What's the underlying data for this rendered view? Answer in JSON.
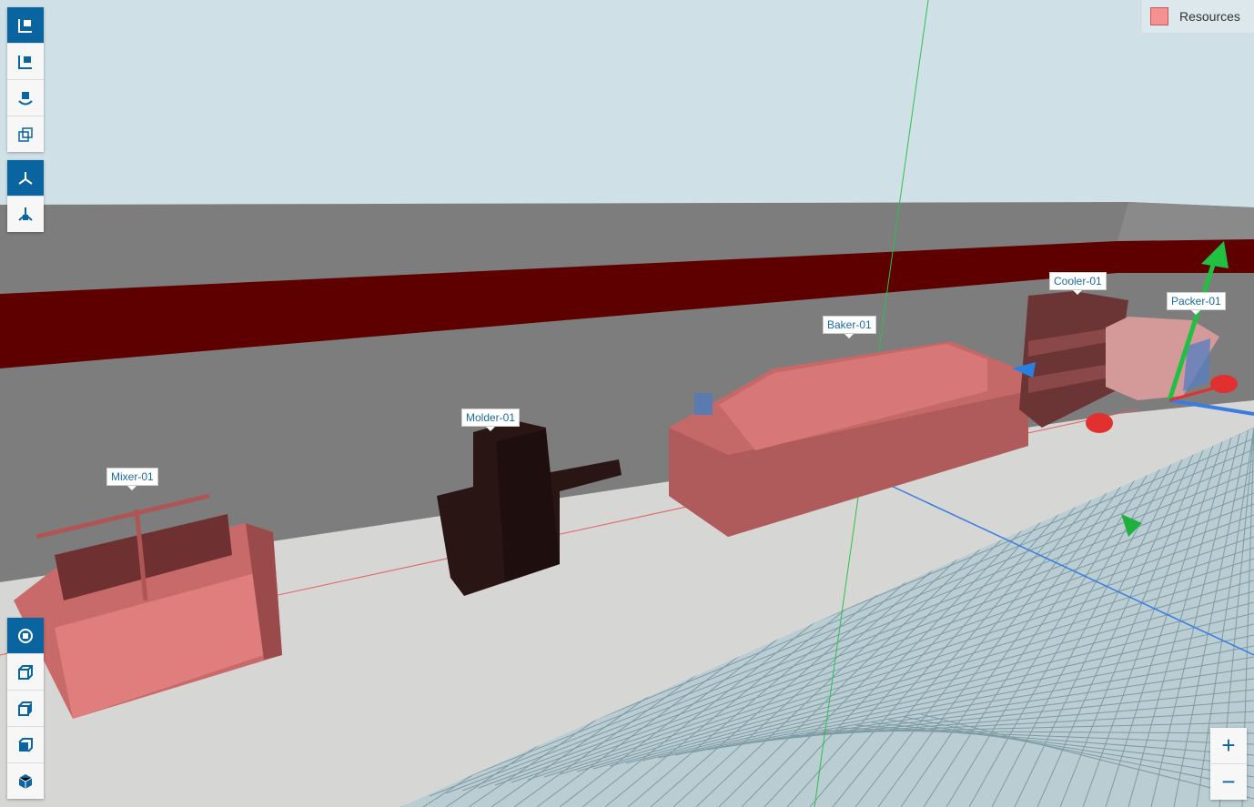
{
  "legend": {
    "label": "Resources",
    "color": "#f59191"
  },
  "labels": {
    "mixer": "Mixer-01",
    "molder": "Molder-01",
    "baker": "Baker-01",
    "cooler": "Cooler-01",
    "packer": "Packer-01"
  },
  "top_toolbar": [
    {
      "icon": "move-object-icon",
      "active": true
    },
    {
      "icon": "move-object-axes-icon",
      "active": false
    },
    {
      "icon": "rotate-object-icon",
      "active": false
    },
    {
      "icon": "scale-object-icon",
      "active": false
    }
  ],
  "axis_toolbar": [
    {
      "icon": "world-axes-icon",
      "active": true
    },
    {
      "icon": "local-axes-icon",
      "active": false
    }
  ],
  "view_toolbar": [
    {
      "icon": "orbit-view-icon",
      "active": true
    },
    {
      "icon": "front-view-icon",
      "active": false
    },
    {
      "icon": "side-view-icon",
      "active": false
    },
    {
      "icon": "top-view-icon",
      "active": false
    },
    {
      "icon": "iso-view-icon",
      "active": false
    }
  ],
  "zoom": {
    "in": "+",
    "out": "−"
  }
}
